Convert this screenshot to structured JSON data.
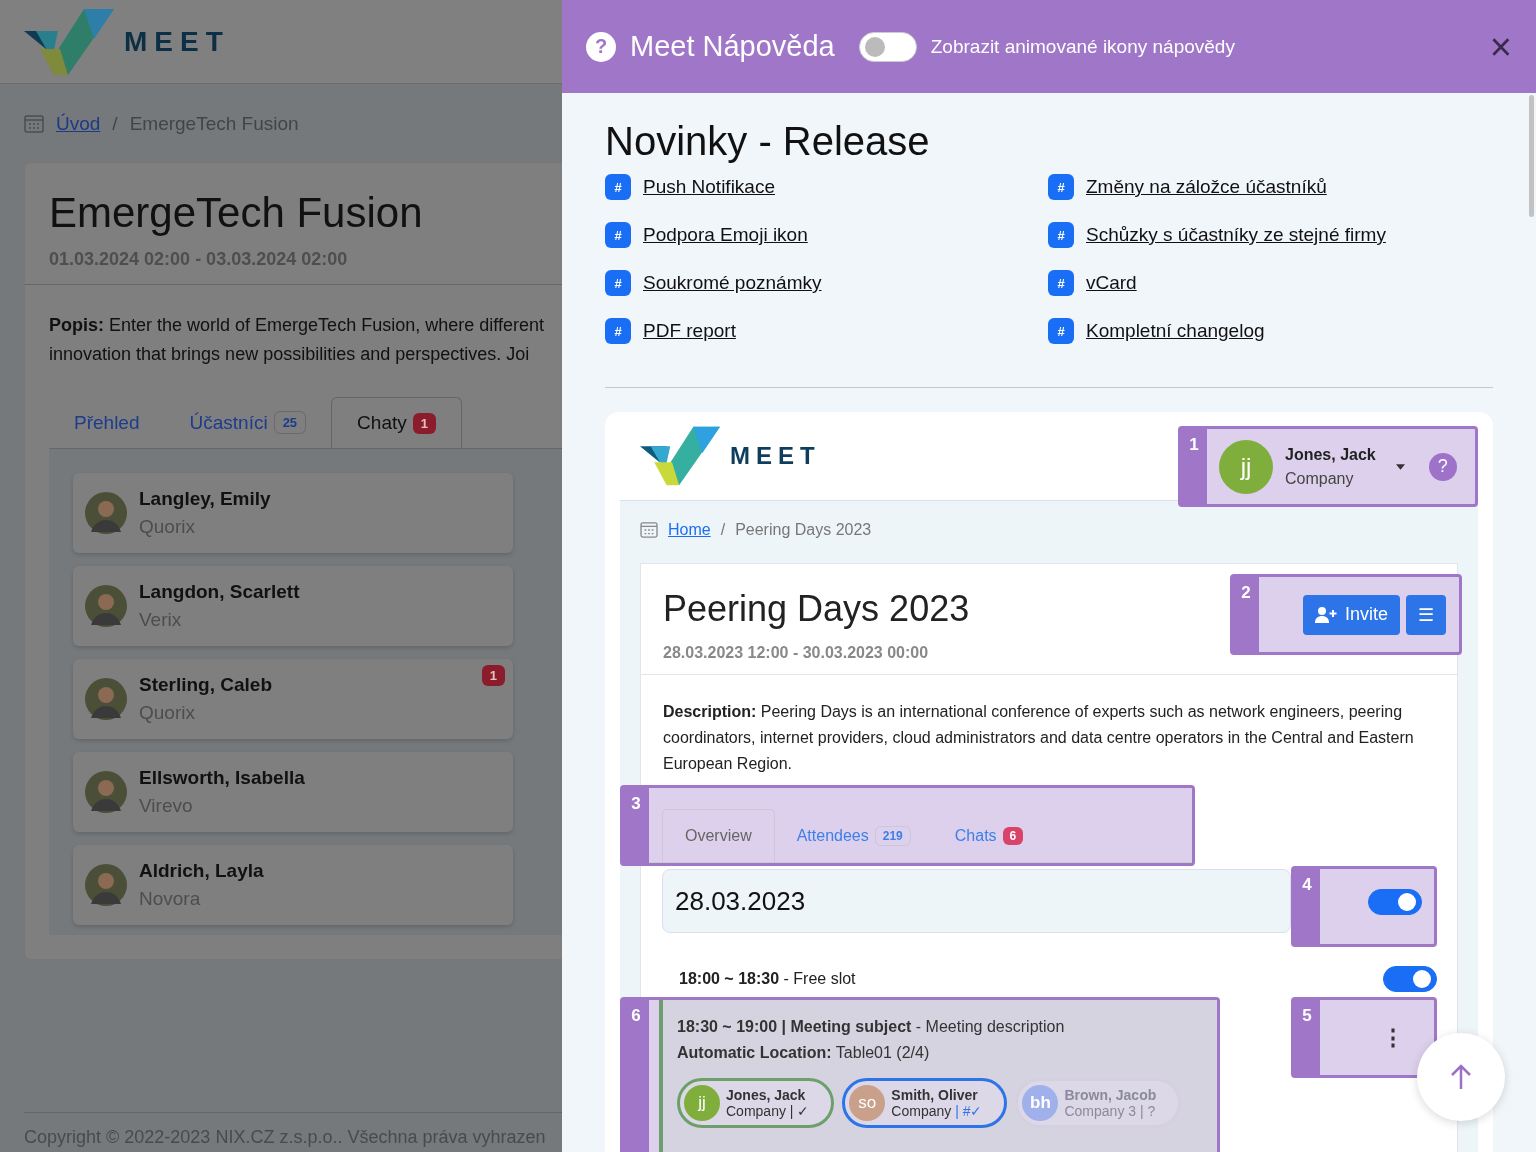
{
  "background_page": {
    "logo": "MEET",
    "breadcrumb": {
      "home": "Úvod",
      "separator": "/",
      "current": "EmergeTech Fusion"
    },
    "event": {
      "title": "EmergeTech Fusion",
      "dates": "01.03.2024 02:00 - 03.03.2024 02:00",
      "description_lines": [
        "**Popis:** Enter the world of EmergeTech Fusion, where different",
        "innovation that brings new possibilities and perspectives. Joi"
      ]
    },
    "tabs": [
      {
        "label": "Přehled",
        "selected": false
      },
      {
        "label": "Účastníci",
        "badge": {
          "text": "25",
          "kind": "outline"
        },
        "selected": false
      },
      {
        "label": "Chaty",
        "badge": {
          "text": "1",
          "kind": "alert"
        },
        "selected": true
      }
    ],
    "chats": [
      {
        "name": "Langley, Emily",
        "company": "Quorix"
      },
      {
        "name": "Langdon, Scarlett",
        "company": "Verix"
      },
      {
        "name": "Sterling, Caleb",
        "company": "Quorix",
        "unread": "1"
      },
      {
        "name": "Ellsworth, Isabella",
        "company": "Virevo"
      },
      {
        "name": "Aldrich, Layla",
        "company": "Novora"
      }
    ],
    "footer": "Copyright © 2022-2023 NIX.CZ z.s.p.o.. Všechna práva vyhrazen"
  },
  "help_drawer": {
    "help_badge": "?",
    "title": "Meet Nápověda",
    "animated_icons_toggle": {
      "on": false,
      "label": "Zobrazit animované ikony nápovědy"
    },
    "close": "×",
    "heading": "Novinky - Release",
    "links": [
      {
        "badge": "#",
        "label": "Push Notifikace"
      },
      {
        "badge": "#",
        "label": "Změny na záložce účastníků"
      },
      {
        "badge": "#",
        "label": "Podpora Emoji ikon"
      },
      {
        "badge": "#",
        "label": "Schůzky s účastníky ze stejné firmy"
      },
      {
        "badge": "#",
        "label": "Soukromé poznámky"
      },
      {
        "badge": "#",
        "label": "vCard"
      },
      {
        "badge": "#",
        "label": "PDF report"
      },
      {
        "badge": "#",
        "label": "Kompletní changelog"
      }
    ],
    "preview": {
      "logo": "MEET",
      "user": {
        "step": "1",
        "initials": "jj",
        "color": "#7fae3c",
        "name": "Jones, Jack",
        "company": "Company",
        "help": "?"
      },
      "breadcrumb": {
        "home": "Home",
        "separator": "/",
        "current": "Peering Days 2023"
      },
      "event": {
        "title": "Peering Days 2023",
        "dates": "28.03.2023 12:00 - 30.03.2023 00:00",
        "actions": {
          "step": "2",
          "invite": "Invite",
          "menu": "☰"
        },
        "description": "**Description:** Peering Days is an international conference of experts such as network engineers, peering coordinators, internet providers, cloud administrators and data centre operators in the Central and Eastern European Region."
      },
      "tabs": {
        "step": "3",
        "items": [
          {
            "label": "Overview",
            "selected": true
          },
          {
            "label": "Attendees",
            "badge": {
              "text": "219",
              "kind": "outline"
            },
            "selected": false
          },
          {
            "label": "Chats",
            "badge": {
              "text": "6",
              "kind": "alert"
            },
            "selected": false
          }
        ]
      },
      "day": {
        "date": "28.03.2023",
        "step": "4",
        "toggle_on": true
      },
      "free_slot": {
        "text": "**18:00 ~ 18:30** - Free slot",
        "toggle_on": true
      },
      "meeting": {
        "step": "6",
        "title": "**18:30 ~ 19:00 | Meeting subject** - Meeting description",
        "location": "**Automatic Location:** Table01 (2/4)",
        "participants": [
          {
            "initials": "jj",
            "color": "#7fae3c",
            "name": "Jones, Jack",
            "company": "Company",
            "status": "| ✓",
            "kind": "accepted"
          },
          {
            "initials": "so",
            "color": "#c9a08a",
            "name": "Smith, Oliver",
            "company": "Company",
            "status": "| #✓",
            "kind": "host"
          },
          {
            "initials": "bh",
            "color": "#9fb0ea",
            "name": "Brown, Jacob",
            "company": "Company 3",
            "status": "| ?",
            "kind": "pending"
          }
        ]
      },
      "menu": {
        "step": "5",
        "icon": "⋮"
      }
    }
  }
}
